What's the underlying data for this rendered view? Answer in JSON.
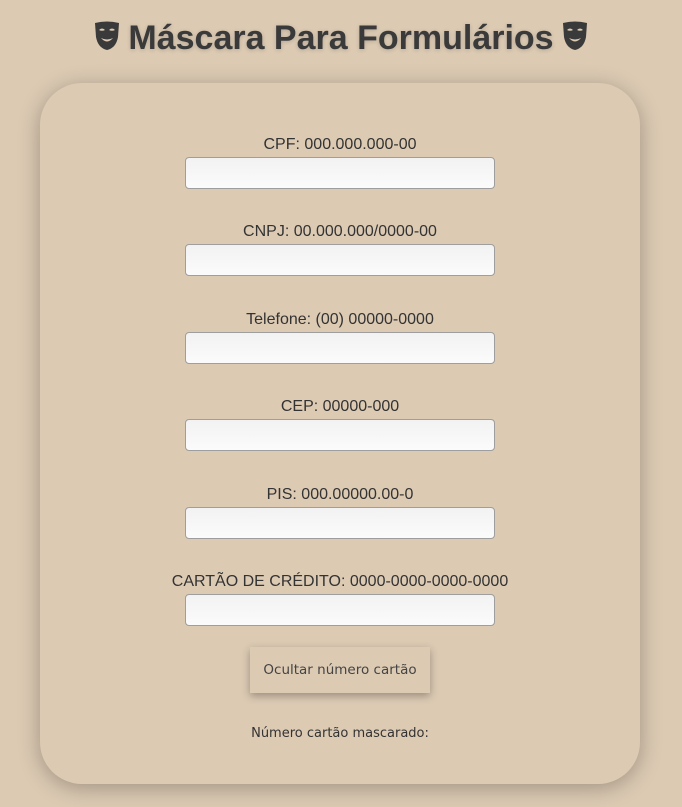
{
  "header": {
    "title": "Máscara Para Formulários",
    "left_icon": "theater-mask-icon",
    "right_icon": "theater-mask-icon"
  },
  "form": {
    "fields": [
      {
        "label": "CPF: 000.000.000-00",
        "value": "",
        "placeholder": ""
      },
      {
        "label": "CNPJ: 00.000.000/0000-00",
        "value": "",
        "placeholder": ""
      },
      {
        "label": "Telefone: (00) 00000-0000",
        "value": "",
        "placeholder": ""
      },
      {
        "label": "CEP: 00000-000",
        "value": "",
        "placeholder": ""
      },
      {
        "label": "PIS: 000.00000.00-0",
        "value": "",
        "placeholder": ""
      },
      {
        "label": "CARTÃO DE CRÉDITO: 0000-0000-0000-0000",
        "value": "",
        "placeholder": ""
      }
    ],
    "hide_button_label": "Ocultar número cartão",
    "masked_label": "Número cartão mascarado:",
    "masked_value": ""
  },
  "colors": {
    "background": "#dccab3",
    "text": "#333333",
    "title": "#3a3a3a"
  }
}
